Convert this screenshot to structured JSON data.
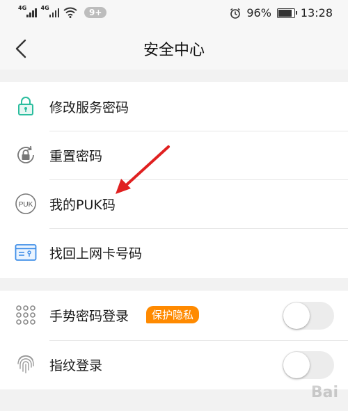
{
  "status_bar": {
    "net1": "4G",
    "net2": "4G",
    "notification_count": "9+",
    "battery": "96%",
    "battery_level": 0.96,
    "time": "13:28"
  },
  "nav": {
    "title": "安全中心"
  },
  "security_items": [
    {
      "label": "修改服务密码",
      "icon": "lock-icon"
    },
    {
      "label": "重置密码",
      "icon": "reset-lock-icon"
    },
    {
      "label": "我的PUK码",
      "icon": "puk-icon",
      "icon_text": "PUK"
    },
    {
      "label": "找回上网卡号码",
      "icon": "sim-card-icon"
    }
  ],
  "login_items": [
    {
      "label": "手势密码登录",
      "icon": "gesture-dots-icon",
      "tag": "保护隐私",
      "toggle_on": false
    },
    {
      "label": "指纹登录",
      "icon": "fingerprint-icon",
      "toggle_on": false
    }
  ],
  "colors": {
    "accent": "#2bbd9e",
    "tag": "#ff8a00",
    "arrow": "#e02020"
  },
  "watermark": "Bai"
}
